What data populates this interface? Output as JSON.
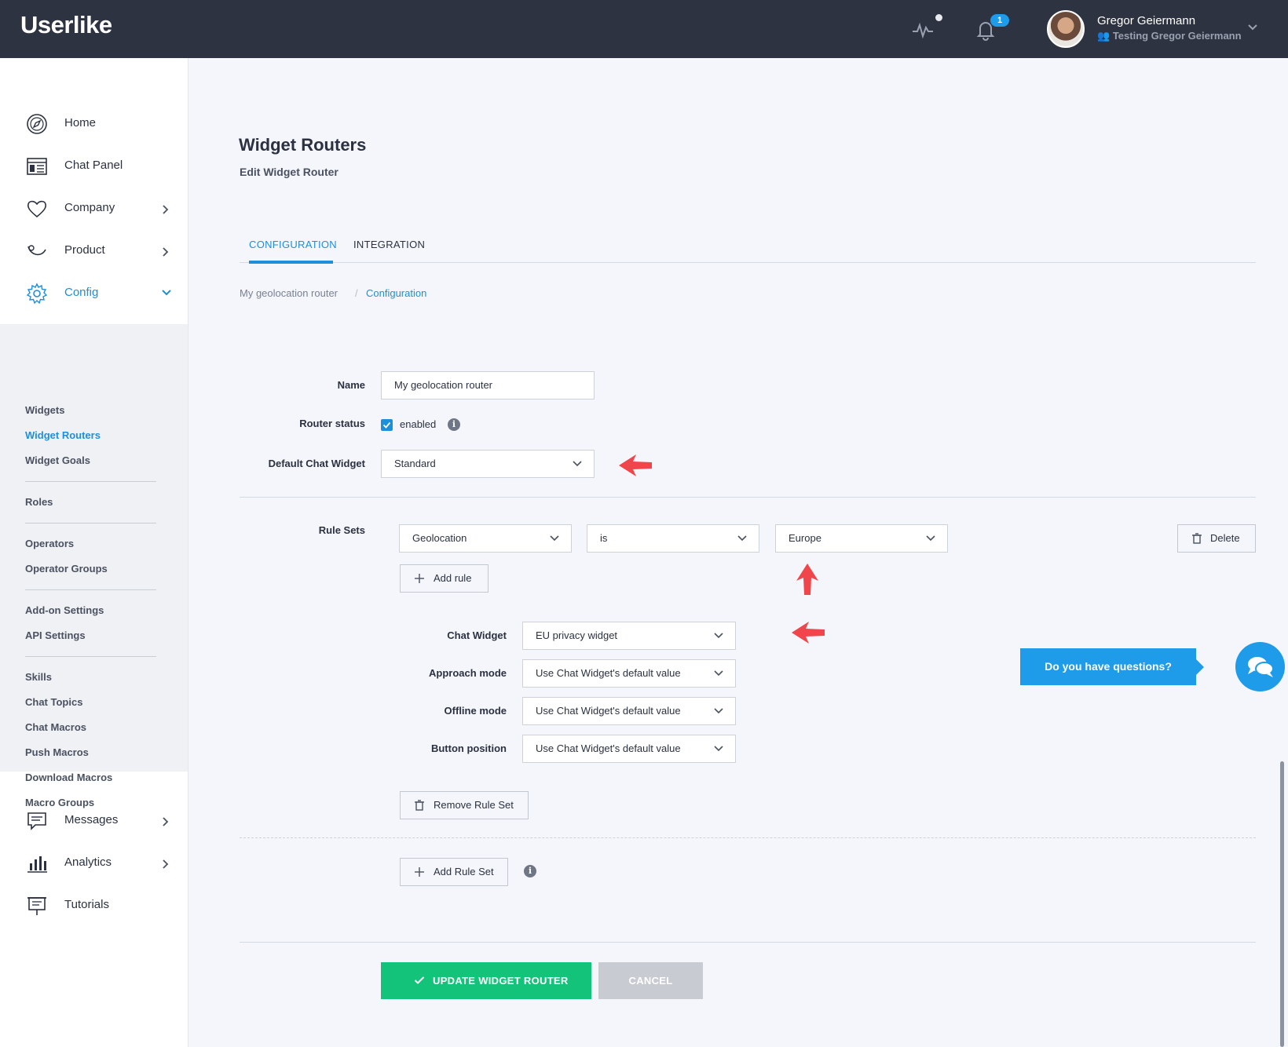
{
  "header": {
    "logo": "Userlike",
    "notification_count": "1",
    "user_name": "Gregor Geiermann",
    "user_subtitle": "Testing Gregor Geiermann"
  },
  "sidebar": {
    "main": [
      {
        "label": "Home",
        "icon": "compass-icon"
      },
      {
        "label": "Chat Panel",
        "icon": "chat-panel-icon"
      },
      {
        "label": "Company",
        "icon": "heart-icon"
      },
      {
        "label": "Product",
        "icon": "product-icon"
      },
      {
        "label": "Config",
        "icon": "gear-icon"
      }
    ],
    "sub": [
      "Widgets",
      "Widget Routers",
      "Widget Goals",
      "Roles",
      "Operators",
      "Operator Groups",
      "Add-on Settings",
      "API Settings",
      "Skills",
      "Chat Topics",
      "Chat Macros",
      "Push Macros",
      "Download Macros",
      "Macro Groups"
    ],
    "bottom": [
      {
        "label": "Messages",
        "icon": "messages-icon"
      },
      {
        "label": "Analytics",
        "icon": "analytics-icon"
      },
      {
        "label": "Tutorials",
        "icon": "tutorials-icon"
      }
    ]
  },
  "page": {
    "title": "Widget Routers",
    "subtitle": "Edit Widget Router",
    "tabs": [
      "CONFIGURATION",
      "INTEGRATION"
    ],
    "breadcrumb": [
      "My geolocation router",
      "Configuration"
    ]
  },
  "form": {
    "name_label": "Name",
    "name_value": "My geolocation router",
    "status_label": "Router status",
    "status_value": "enabled",
    "default_widget_label": "Default Chat Widget",
    "default_widget_value": "Standard",
    "rule_sets_label": "Rule Sets",
    "rule": {
      "field": "Geolocation",
      "operator": "is",
      "value": "Europe"
    },
    "delete_label": "Delete",
    "add_rule_label": "Add rule",
    "chat_widget_label": "Chat Widget",
    "chat_widget_value": "EU privacy widget",
    "approach_label": "Approach mode",
    "approach_value": "Use Chat Widget's default value",
    "offline_label": "Offline mode",
    "offline_value": "Use Chat Widget's default value",
    "button_pos_label": "Button position",
    "button_pos_value": "Use Chat Widget's default value",
    "remove_rule_set_label": "Remove Rule Set",
    "add_rule_set_label": "Add Rule Set",
    "update_label": "UPDATE WIDGET ROUTER",
    "cancel_label": "CANCEL"
  },
  "chat_widget": {
    "prompt": "Do you have questions?"
  },
  "colors": {
    "accent": "#1e8fd8",
    "success": "#14c37a",
    "annotation": "#f0464b",
    "topbar": "#2d3340"
  }
}
